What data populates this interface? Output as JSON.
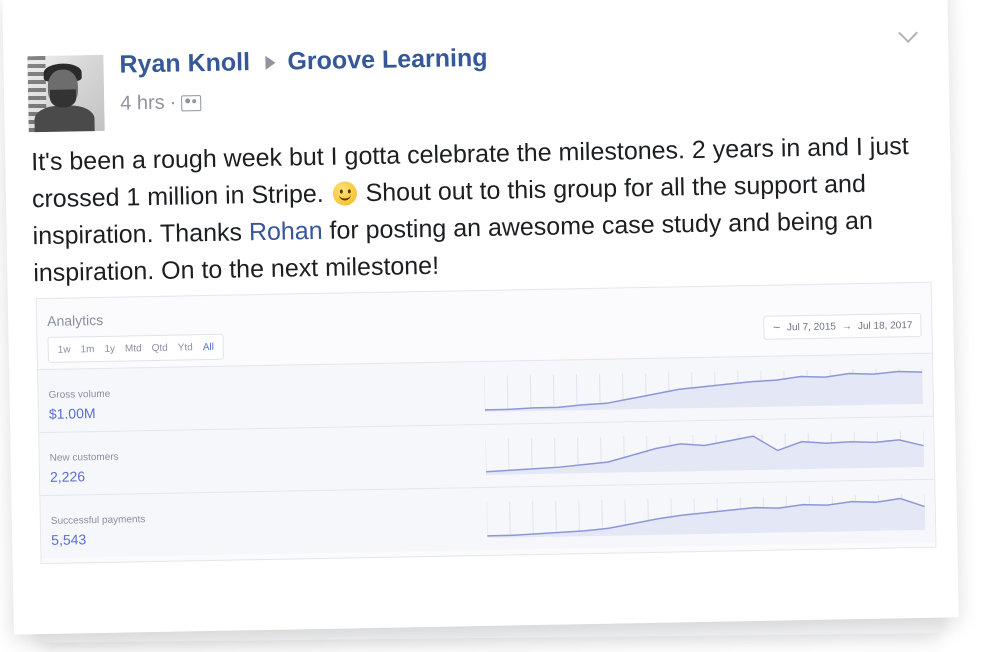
{
  "post": {
    "author": "Ryan Knoll",
    "group": "Groove Learning",
    "time": "4 hrs",
    "dot": "·",
    "text_part1": "It's been a rough week but I gotta celebrate the milestones. 2 years in and I just crossed 1 million in Stripe.",
    "text_part2": " Shout out to this group for all the support and inspiration. Thanks ",
    "mention": "Rohan",
    "text_part3": " for posting an awesome case study and being an inspiration. On to the next milestone!"
  },
  "analytics": {
    "title": "Analytics",
    "filters": [
      "1w",
      "1m",
      "1y",
      "Mtd",
      "Qtd",
      "Ytd",
      "All"
    ],
    "active_filter": "All",
    "date_start": "Jul 7, 2015",
    "date_end": "Jul 18, 2017",
    "rows": [
      {
        "label": "Gross volume",
        "value": "$1.00M",
        "spark": [
          2,
          2,
          3,
          3,
          5,
          6,
          10,
          14,
          18,
          20,
          22,
          24,
          25,
          28,
          27,
          30,
          29,
          31,
          30
        ]
      },
      {
        "label": "New customers",
        "value": "2,226",
        "spark": [
          3,
          4,
          5,
          6,
          8,
          10,
          16,
          22,
          26,
          24,
          28,
          32,
          18,
          26,
          24,
          25,
          24,
          26,
          20
        ]
      },
      {
        "label": "Successful payments",
        "value": "5,543",
        "spark": [
          2,
          2,
          3,
          4,
          5,
          7,
          11,
          15,
          18,
          20,
          22,
          24,
          23,
          26,
          25,
          28,
          27,
          30,
          22
        ]
      }
    ]
  },
  "colors": {
    "link": "#365899",
    "accent": "#5b6ed6"
  },
  "icons": [
    "group-audience-icon",
    "chevron-down-icon",
    "smiley-emoji-icon",
    "trend-icon",
    "arrow-right-icon",
    "play-arrow-icon"
  ]
}
